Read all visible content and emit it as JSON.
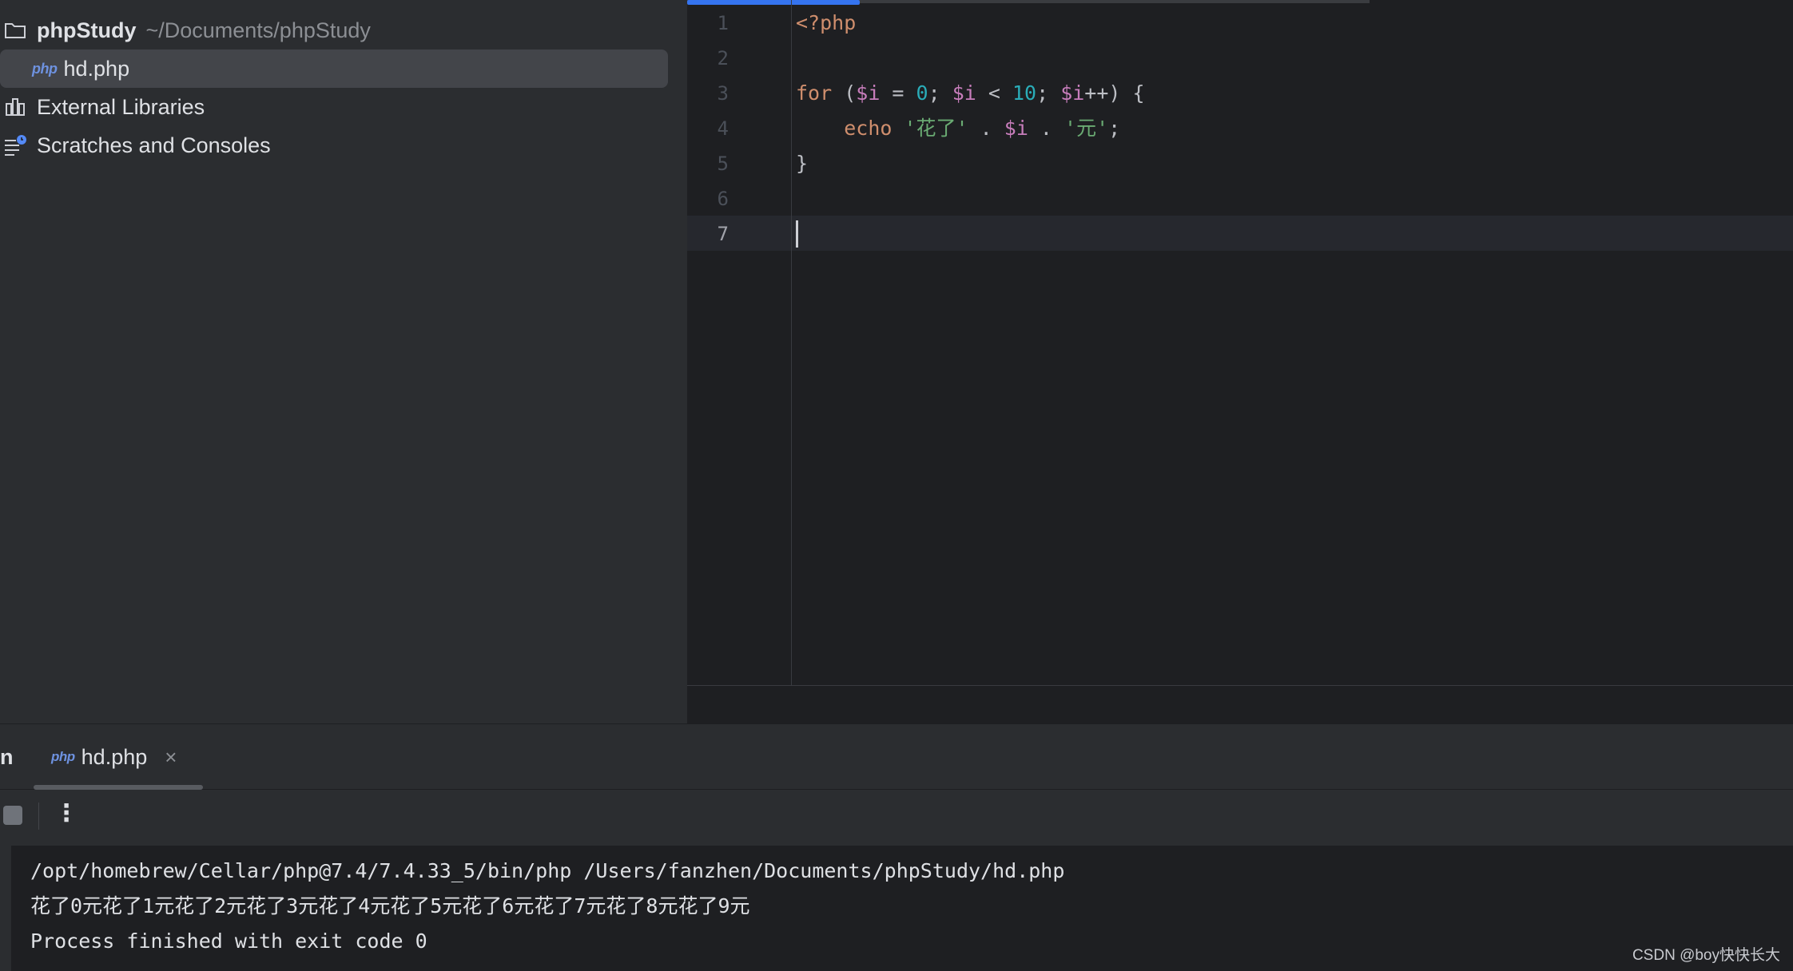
{
  "project_tree": {
    "root_name": "phpStudy",
    "root_path": "~/Documents/phpStudy",
    "file_badge": "php",
    "file_name": "hd.php",
    "external_libraries": "External Libraries",
    "scratches": "Scratches and Consoles"
  },
  "editor": {
    "line_numbers": [
      "1",
      "2",
      "3",
      "4",
      "5",
      "6",
      "7"
    ],
    "current_line": "7",
    "code": {
      "l1_open_tag": "<?php",
      "l3_for": "for",
      "l3_paren_open": " (",
      "l3_var1": "$i",
      "l3_eq": " = ",
      "l3_zero": "0",
      "l3_semi1": "; ",
      "l3_var2": "$i",
      "l3_lt": " < ",
      "l3_ten": "10",
      "l3_semi2": "; ",
      "l3_var3": "$i",
      "l3_tail": "++) {",
      "l4_indent": "    ",
      "l4_echo": "echo",
      "l4_space": " ",
      "l4_str1": "'花了'",
      "l4_dot1": " . ",
      "l4_var": "$i",
      "l4_dot2": " . ",
      "l4_str2": "'元'",
      "l4_semi": ";",
      "l5_close": "}"
    }
  },
  "run_window": {
    "title_fragment": "n",
    "tab_badge": "php",
    "tab_label": "hd.php",
    "tab_close": "×",
    "more_icon": "⋮",
    "console_lines": [
      "/opt/homebrew/Cellar/php@7.4/7.4.33_5/bin/php /Users/fanzhen/Documents/phpStudy/hd.php",
      "花了0元花了1元花了2元花了3元花了4元花了5元花了6元花了7元花了8元花了9元",
      "Process finished with exit code 0"
    ]
  },
  "watermark": "CSDN @boy快快长大",
  "colors": {
    "keyword": "#cf8e6d",
    "variable": "#c77dbb",
    "number": "#2aacb8",
    "string": "#6aab73",
    "accent": "#3574f0"
  }
}
